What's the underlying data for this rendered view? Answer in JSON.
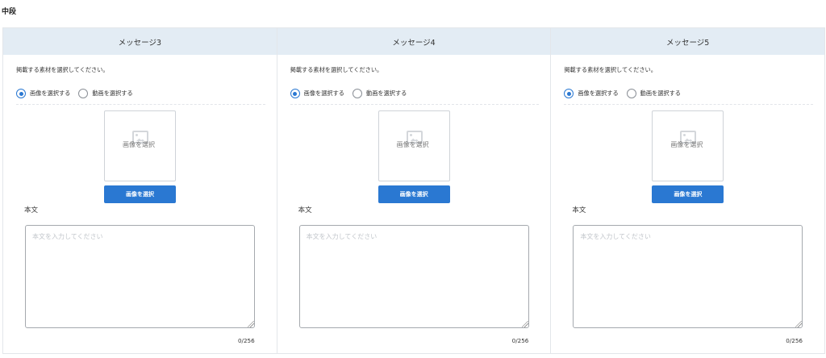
{
  "section": {
    "title": "中段"
  },
  "panels": [
    {
      "header": "メッセージ3",
      "instruction": "掲載する素材を選択してください。",
      "radio_image_label": "画像を選択する",
      "radio_video_label": "動画を選択する",
      "selected": "image",
      "image_placeholder": "画像を選択",
      "select_button_label": "画像を選択",
      "body_label": "本文",
      "body_value": "",
      "body_placeholder": "本文を入力してください",
      "char_count": "0/256"
    },
    {
      "header": "メッセージ4",
      "instruction": "掲載する素材を選択してください。",
      "radio_image_label": "画像を選択する",
      "radio_video_label": "動画を選択する",
      "selected": "image",
      "image_placeholder": "画像を選択",
      "select_button_label": "画像を選択",
      "body_label": "本文",
      "body_value": "",
      "body_placeholder": "本文を入力してください",
      "char_count": "0/256"
    },
    {
      "header": "メッセージ5",
      "instruction": "掲載する素材を選択してください。",
      "radio_image_label": "画像を選択する",
      "radio_video_label": "動画を選択する",
      "selected": "image",
      "image_placeholder": "画像を選択",
      "select_button_label": "画像を選択",
      "body_label": "本文",
      "body_value": "",
      "body_placeholder": "本文を入力してください",
      "char_count": "0/256"
    }
  ],
  "colors": {
    "accent": "#2a78d2",
    "header_bg": "#e3ecf4"
  }
}
